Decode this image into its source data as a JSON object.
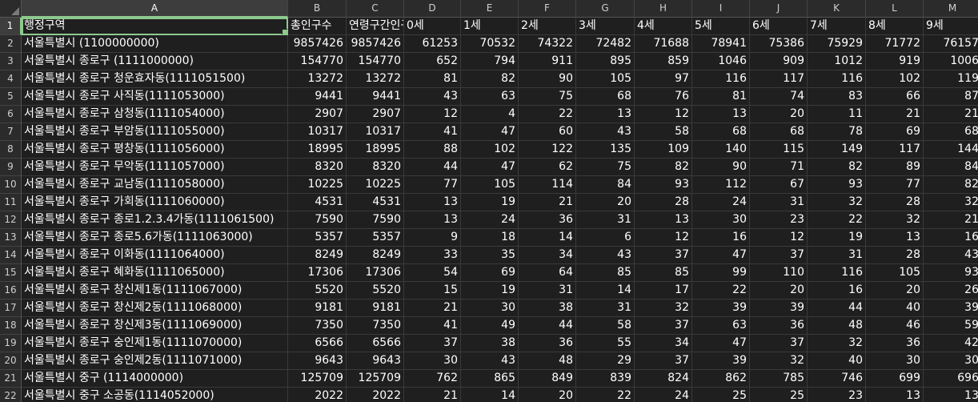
{
  "columns": [
    "A",
    "B",
    "C",
    "D",
    "E",
    "F",
    "G",
    "H",
    "I",
    "J",
    "K",
    "L",
    "M"
  ],
  "active_cell": "A1",
  "rows": [
    [
      "행정구역",
      "총인구수",
      "연령구간인구수",
      "0세",
      "1세",
      "2세",
      "3세",
      "4세",
      "5세",
      "6세",
      "7세",
      "8세",
      "9세"
    ],
    [
      "서울특별시  (1100000000)",
      "9857426",
      "9857426",
      "61253",
      "70532",
      "74322",
      "72482",
      "71688",
      "78941",
      "75386",
      "75929",
      "71772",
      "76157"
    ],
    [
      "서울특별시 종로구 (1111000000)",
      "154770",
      "154770",
      "652",
      "794",
      "911",
      "895",
      "859",
      "1046",
      "909",
      "1012",
      "919",
      "1006"
    ],
    [
      "서울특별시 종로구 청운효자동(1111051500)",
      "13272",
      "13272",
      "81",
      "82",
      "90",
      "105",
      "97",
      "116",
      "117",
      "116",
      "102",
      "119"
    ],
    [
      "서울특별시 종로구 사직동(1111053000)",
      "9441",
      "9441",
      "43",
      "63",
      "75",
      "68",
      "76",
      "81",
      "74",
      "83",
      "66",
      "87"
    ],
    [
      "서울특별시 종로구 삼청동(1111054000)",
      "2907",
      "2907",
      "12",
      "4",
      "22",
      "13",
      "12",
      "13",
      "20",
      "11",
      "21",
      "21"
    ],
    [
      "서울특별시 종로구 부암동(1111055000)",
      "10317",
      "10317",
      "41",
      "47",
      "60",
      "43",
      "58",
      "68",
      "68",
      "78",
      "69",
      "68"
    ],
    [
      "서울특별시 종로구 평창동(1111056000)",
      "18995",
      "18995",
      "88",
      "102",
      "122",
      "135",
      "109",
      "140",
      "115",
      "149",
      "117",
      "144"
    ],
    [
      "서울특별시 종로구 무악동(1111057000)",
      "8320",
      "8320",
      "44",
      "47",
      "62",
      "75",
      "82",
      "90",
      "71",
      "82",
      "89",
      "84"
    ],
    [
      "서울특별시 종로구 교남동(1111058000)",
      "10225",
      "10225",
      "77",
      "105",
      "114",
      "84",
      "93",
      "112",
      "67",
      "93",
      "77",
      "82"
    ],
    [
      "서울특별시 종로구 가회동(1111060000)",
      "4531",
      "4531",
      "13",
      "19",
      "21",
      "20",
      "28",
      "24",
      "31",
      "32",
      "28",
      "32"
    ],
    [
      "서울특별시 종로구 종로1.2.3.4가동(1111061500)",
      "7590",
      "7590",
      "13",
      "24",
      "36",
      "31",
      "13",
      "30",
      "23",
      "22",
      "32",
      "21"
    ],
    [
      "서울특별시 종로구 종로5.6가동(1111063000)",
      "5357",
      "5357",
      "9",
      "18",
      "14",
      "6",
      "12",
      "16",
      "12",
      "19",
      "13",
      "16"
    ],
    [
      "서울특별시 종로구 이화동(1111064000)",
      "8249",
      "8249",
      "33",
      "35",
      "34",
      "43",
      "37",
      "47",
      "37",
      "31",
      "28",
      "43"
    ],
    [
      "서울특별시 종로구 혜화동(1111065000)",
      "17306",
      "17306",
      "54",
      "69",
      "64",
      "85",
      "85",
      "99",
      "110",
      "116",
      "105",
      "93"
    ],
    [
      "서울특별시 종로구 창신제1동(1111067000)",
      "5520",
      "5520",
      "15",
      "19",
      "31",
      "14",
      "17",
      "22",
      "20",
      "16",
      "20",
      "26"
    ],
    [
      "서울특별시 종로구 창신제2동(1111068000)",
      "9181",
      "9181",
      "21",
      "30",
      "38",
      "31",
      "32",
      "39",
      "39",
      "44",
      "40",
      "39"
    ],
    [
      "서울특별시 종로구 창신제3동(1111069000)",
      "7350",
      "7350",
      "41",
      "49",
      "44",
      "58",
      "37",
      "63",
      "36",
      "48",
      "46",
      "59"
    ],
    [
      "서울특별시 종로구 숭인제1동(1111070000)",
      "6566",
      "6566",
      "37",
      "38",
      "36",
      "55",
      "34",
      "47",
      "37",
      "32",
      "36",
      "42"
    ],
    [
      "서울특별시 종로구 숭인제2동(1111071000)",
      "9643",
      "9643",
      "30",
      "43",
      "48",
      "29",
      "37",
      "39",
      "32",
      "40",
      "30",
      "30"
    ],
    [
      "서울특별시 중구 (1114000000)",
      "125709",
      "125709",
      "762",
      "865",
      "849",
      "839",
      "824",
      "862",
      "785",
      "746",
      "699",
      "696"
    ],
    [
      "서울특별시 중구 소공동(1114052000)",
      "2022",
      "2022",
      "21",
      "14",
      "20",
      "22",
      "24",
      "25",
      "25",
      "23",
      "13",
      "13"
    ]
  ]
}
